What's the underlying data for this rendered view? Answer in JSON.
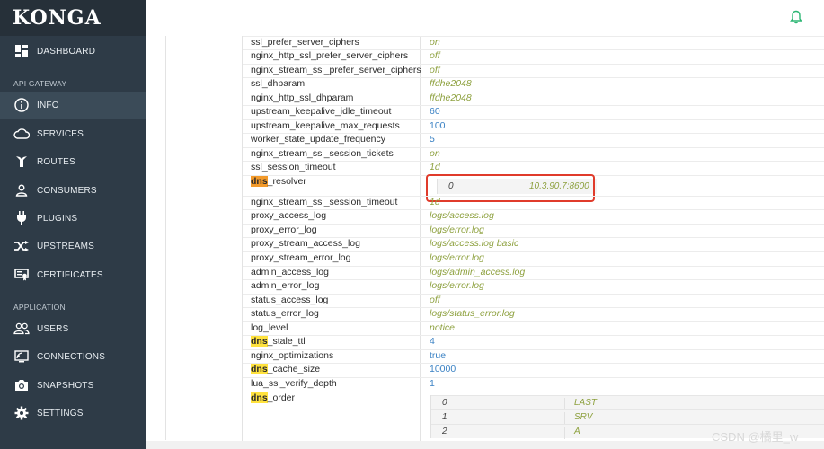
{
  "app": {
    "logo": "KONGA"
  },
  "sidebar": {
    "dashboard": "DASHBOARD",
    "section_gateway": "API GATEWAY",
    "info": "INFO",
    "services": "SERVICES",
    "routes": "ROUTES",
    "consumers": "CONSUMERS",
    "plugins": "PLUGINS",
    "upstreams": "UPSTREAMS",
    "certificates": "CERTIFICATES",
    "section_application": "APPLICATION",
    "users": "USERS",
    "connections": "CONNECTIONS",
    "snapshots": "SNAPSHOTS",
    "settings": "SETTINGS"
  },
  "config": {
    "r0": {
      "key": "ssl_prefer_server_ciphers",
      "value": "on"
    },
    "r1": {
      "key": "nginx_http_ssl_prefer_server_ciphers",
      "value": "off"
    },
    "r2": {
      "key": "nginx_stream_ssl_prefer_server_ciphers",
      "value": "off"
    },
    "r3": {
      "key": "ssl_dhparam",
      "value": "ffdhe2048"
    },
    "r4": {
      "key": "nginx_http_ssl_dhparam",
      "value": "ffdhe2048"
    },
    "r5": {
      "key": "upstream_keepalive_idle_timeout",
      "value": "60"
    },
    "r6": {
      "key": "upstream_keepalive_max_requests",
      "value": "100"
    },
    "r7": {
      "key": "worker_state_update_frequency",
      "value": "5"
    },
    "r8": {
      "key": "nginx_stream_ssl_session_tickets",
      "value": "on"
    },
    "r9": {
      "key": "ssl_session_timeout",
      "value": "1d"
    },
    "dns_resolver": {
      "key_hl": "dns",
      "key_rest": "_resolver",
      "index": "0",
      "value": "10.3.90.7:8600"
    },
    "r11": {
      "key": "nginx_stream_ssl_session_timeout",
      "value": "1d"
    },
    "r12": {
      "key": "proxy_access_log",
      "value": "logs/access.log"
    },
    "r13": {
      "key": "proxy_error_log",
      "value": "logs/error.log"
    },
    "r14": {
      "key": "proxy_stream_access_log",
      "value": "logs/access.log basic"
    },
    "r15": {
      "key": "proxy_stream_error_log",
      "value": "logs/error.log"
    },
    "r16": {
      "key": "admin_access_log",
      "value": "logs/admin_access.log"
    },
    "r17": {
      "key": "admin_error_log",
      "value": "logs/error.log"
    },
    "r18": {
      "key": "status_access_log",
      "value": "off"
    },
    "r19": {
      "key": "status_error_log",
      "value": "logs/status_error.log"
    },
    "r20": {
      "key": "log_level",
      "value": "notice"
    },
    "dns_stale_ttl": {
      "key_hl": "dns",
      "key_rest": "_stale_ttl",
      "value": "4"
    },
    "r22": {
      "key": "nginx_optimizations",
      "value": "true"
    },
    "dns_cache_size": {
      "key_hl": "dns",
      "key_rest": "_cache_size",
      "value": "10000"
    },
    "r24": {
      "key": "lua_ssl_verify_depth",
      "value": "1"
    },
    "dns_order": {
      "key_hl": "dns",
      "key_rest": "_order",
      "items": [
        {
          "index": "0",
          "value": "LAST"
        },
        {
          "index": "1",
          "value": "SRV"
        },
        {
          "index": "2",
          "value": "A"
        }
      ]
    }
  },
  "watermark": "CSDN @橘里_w",
  "colors": {
    "sidebar": "#2e3b47",
    "value_text": "#8ea13f",
    "number_text": "#3b82c4",
    "highlight": "#ffe23d",
    "highlight_orange": "#f39a2a",
    "callout_box": "#e03b2b",
    "bell": "#2bb673"
  }
}
